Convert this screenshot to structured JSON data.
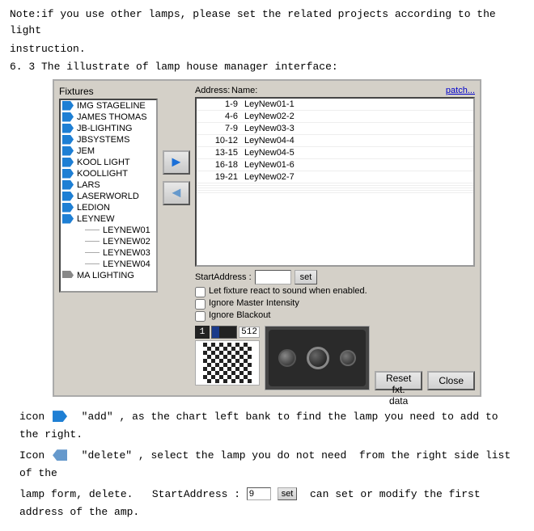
{
  "note": {
    "line1": "Note:if you use other lamps, please set the related projects according to the light",
    "line2": "instruction.",
    "section": "6. 3 The illustrate of lamp house manager interface:"
  },
  "dialog": {
    "fixtures_label": "Fixtures",
    "address_label": "Address:",
    "name_label": "Name:",
    "patch_link": "patch...",
    "fixtures": [
      {
        "name": "IMG STAGELINE",
        "type": "blue"
      },
      {
        "name": "JAMES THOMAS",
        "type": "blue"
      },
      {
        "name": "JB-LIGHTING",
        "type": "blue"
      },
      {
        "name": "JBSYSTEMS",
        "type": "blue"
      },
      {
        "name": "JEM",
        "type": "blue"
      },
      {
        "name": "KOOL LIGHT",
        "type": "blue"
      },
      {
        "name": "KOOLLIGHT",
        "type": "blue"
      },
      {
        "name": "LARS",
        "type": "blue"
      },
      {
        "name": "LASERWORLD",
        "type": "blue"
      },
      {
        "name": "LEDION",
        "type": "blue"
      },
      {
        "name": "LEYNEW",
        "type": "blue"
      },
      {
        "name": "LEYNEW01",
        "type": "sub"
      },
      {
        "name": "LEYNEW02",
        "type": "sub"
      },
      {
        "name": "LEYNEW03",
        "type": "sub"
      },
      {
        "name": "LEYNEW04",
        "type": "sub"
      },
      {
        "name": "MA LIGHTING",
        "type": "blue"
      }
    ],
    "address_entries": [
      {
        "addr": "1-9",
        "name": "LeyNew01-1"
      },
      {
        "addr": "4-6",
        "name": "LeyNew02-2"
      },
      {
        "addr": "7-9",
        "name": "LeyNew03-3"
      },
      {
        "addr": "10-12",
        "name": "LeyNew04-4"
      },
      {
        "addr": "13-15",
        "name": "LeyNew04-5"
      },
      {
        "addr": "16-18",
        "name": "LeyNew01-6"
      },
      {
        "addr": "19-21",
        "name": "LeyNew02-7"
      }
    ],
    "start_address_label": "StartAddress :",
    "start_address_value": "",
    "set_btn": "set",
    "checkbox1": "Let fixture react to sound when enabled.",
    "checkbox2": "Ignore Master Intensity",
    "checkbox3": "Ignore Blackout",
    "reset_btn": "Reset fxt. data",
    "close_btn": "Close",
    "addr_num": "1",
    "addr_max": "512"
  },
  "bottom": {
    "line1_pre": "icon",
    "line1_quote": "“add”",
    "line1_rest": ", as the chart left bank to find the lamp you need to add to the right.",
    "line2_pre": "Icon",
    "line2_quote": "“delete”",
    "line2_rest": ", select the lamp you do not need  from the right side list of the",
    "line3_pre": "lamp form, delete.",
    "line3_start": "StartAddress :",
    "line3_val": "9",
    "line3_set": "set",
    "line3_rest": "can set or modify the first address of the amp."
  }
}
